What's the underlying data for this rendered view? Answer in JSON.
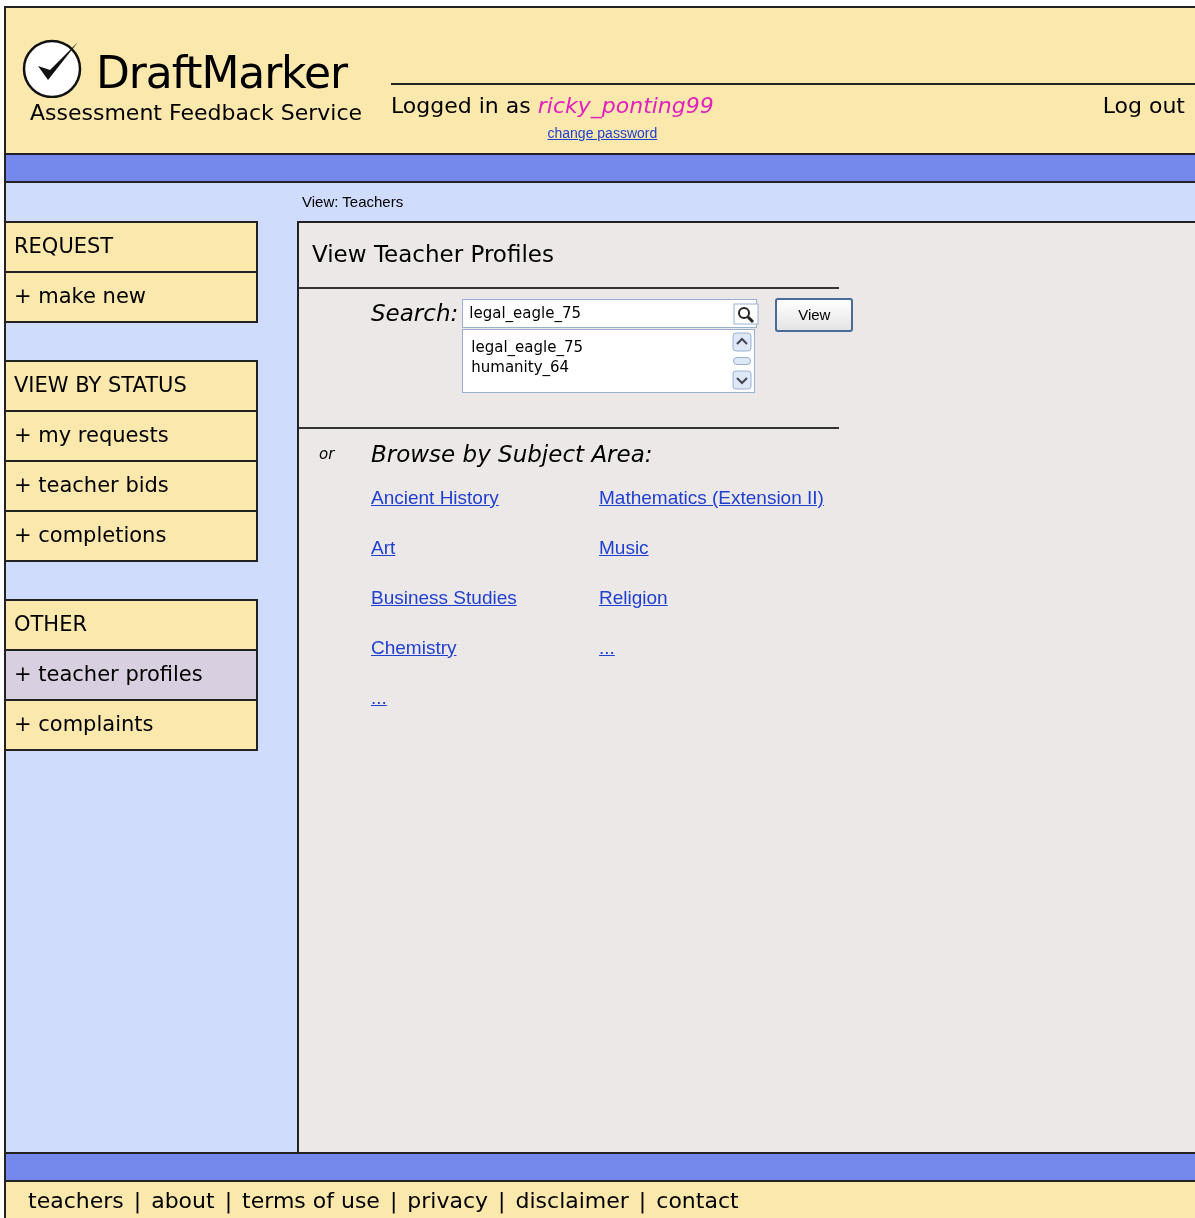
{
  "header": {
    "logo_title": "DraftMarker",
    "tagline": "Assessment Feedback Service",
    "logged_in_label": "Logged in as",
    "username": "ricky_ponting99",
    "change_password": "change password",
    "logout": "Log out"
  },
  "breadcrumb": "View: Teachers",
  "sidebar": [
    {
      "heading": "REQUEST",
      "items": [
        {
          "label": "+ make new",
          "selected": false
        }
      ]
    },
    {
      "heading": "VIEW BY STATUS",
      "items": [
        {
          "label": "+ my requests",
          "selected": false
        },
        {
          "label": "+ teacher bids",
          "selected": false
        },
        {
          "label": "+ completions",
          "selected": false
        }
      ]
    },
    {
      "heading": "OTHER",
      "items": [
        {
          "label": "+ teacher profiles",
          "selected": true
        },
        {
          "label": "+ complaints",
          "selected": false
        }
      ]
    }
  ],
  "main": {
    "title": "View Teacher Profiles",
    "search_label": "Search:",
    "search_value": "legal_eagle_75",
    "suggestions": [
      "legal_eagle_75",
      "humanity_64"
    ],
    "view_button": "View",
    "or_label": "or",
    "browse_label": "Browse by Subject Area:",
    "subject_columns": [
      [
        "Ancient History",
        "Art",
        "Business Studies",
        "Chemistry",
        "..."
      ],
      [
        "Mathematics (Extension II)",
        "Music",
        "Religion",
        "..."
      ]
    ]
  },
  "footer": {
    "separator": "|",
    "links": [
      "teachers",
      "about",
      "terms of use",
      "privacy",
      "disclaimer",
      "contact"
    ]
  }
}
